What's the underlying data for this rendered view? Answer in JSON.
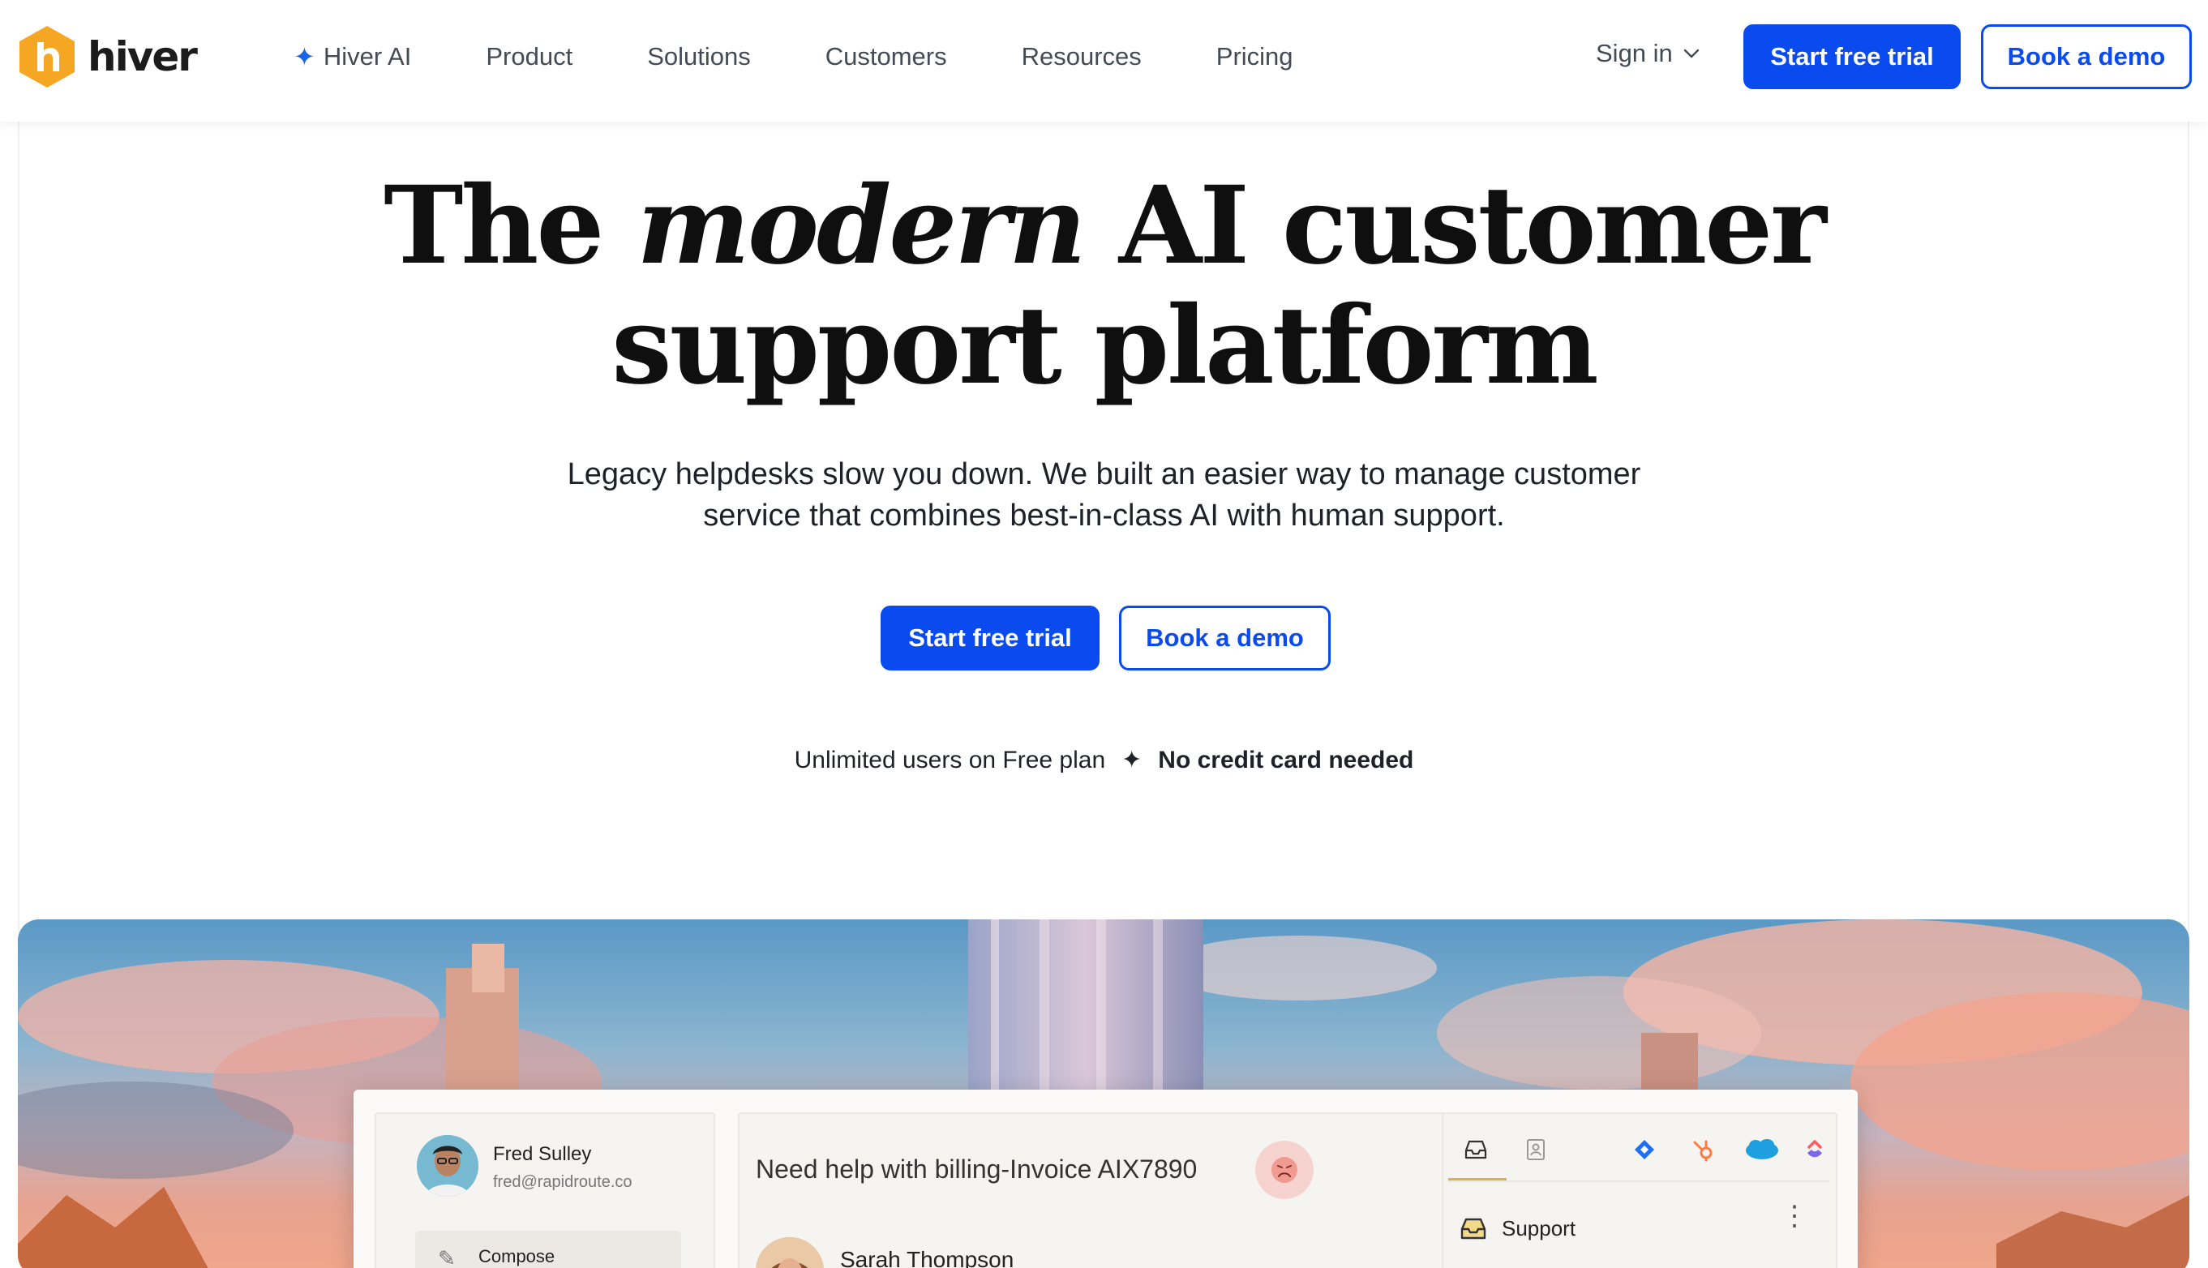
{
  "header": {
    "logo_text": "hiver",
    "nav": [
      {
        "label": "Hiver AI",
        "icon": "sparkle-icon"
      },
      {
        "label": "Product"
      },
      {
        "label": "Solutions"
      },
      {
        "label": "Customers"
      },
      {
        "label": "Resources"
      },
      {
        "label": "Pricing"
      }
    ],
    "signin_label": "Sign in",
    "trial_label": "Start free trial",
    "demo_label": "Book a demo"
  },
  "hero": {
    "title_pre": "The ",
    "title_em": "modern",
    "title_post": " AI customer",
    "title_line2": "support platform",
    "subtitle_line1": "Legacy helpdesks slow you down. We built an easier way to manage customer",
    "subtitle_line2": "service that combines best-in-class AI with human support.",
    "cta_trial": "Start free trial",
    "cta_demo": "Book a demo",
    "note_plain": "Unlimited users on Free plan",
    "note_bold": "No credit card needed"
  },
  "app_mock": {
    "user": {
      "name": "Fred Sulley",
      "email": "fred@rapidroute.co"
    },
    "compose_label": "Compose",
    "ticket_title": "Need help with billing-Invoice AIX7890",
    "sender_name": "Sarah Thompson",
    "right_tabs": [
      "inbox-icon",
      "contacts-icon",
      "jira-icon",
      "hubspot-icon",
      "salesforce-icon",
      "clickup-icon"
    ],
    "support_label": "Support"
  },
  "colors": {
    "primary": "#0a4bf0",
    "logo": "#f5a623",
    "accent_sparkle": "#1a63e8"
  }
}
